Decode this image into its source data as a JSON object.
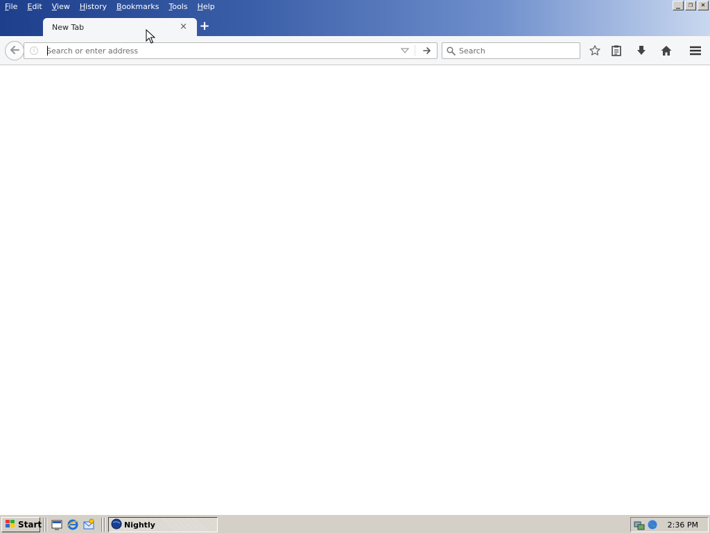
{
  "menubar": {
    "items": [
      {
        "key": "F",
        "rest": "ile"
      },
      {
        "key": "E",
        "rest": "dit"
      },
      {
        "key": "V",
        "rest": "iew"
      },
      {
        "key": "H",
        "rest": "istory"
      },
      {
        "key": "B",
        "rest": "ookmarks"
      },
      {
        "key": "T",
        "rest": "ools"
      },
      {
        "key": "H",
        "rest": "elp"
      }
    ]
  },
  "window_controls": {
    "minimize": "_",
    "restore": "❐",
    "close": "✕"
  },
  "tabs": [
    {
      "label": "New Tab",
      "close_glyph": "×"
    }
  ],
  "new_tab_glyph": "+",
  "urlbar": {
    "value": "",
    "placeholder": "Search or enter address"
  },
  "searchbar": {
    "value": "",
    "placeholder": "Search"
  },
  "toolbar_icons": [
    "back-arrow-icon",
    "bookmark-star-icon",
    "reading-list-icon",
    "download-icon",
    "home-icon",
    "hamburger-menu-icon"
  ],
  "taskbar": {
    "start_label": "Start",
    "quick_launch": [
      "desktop-icon",
      "internet-explorer-icon",
      "outlook-icon"
    ],
    "task_label": "Nightly",
    "tray_icons": [
      "network-icon",
      "globe-icon"
    ],
    "clock": "2:36 PM"
  },
  "colors": {
    "titlebar_start": "#1e3f8c",
    "titlebar_end": "#c9d8ef",
    "toolbar_bg": "#f5f6f7",
    "taskbar_bg": "#d4d0c8"
  }
}
